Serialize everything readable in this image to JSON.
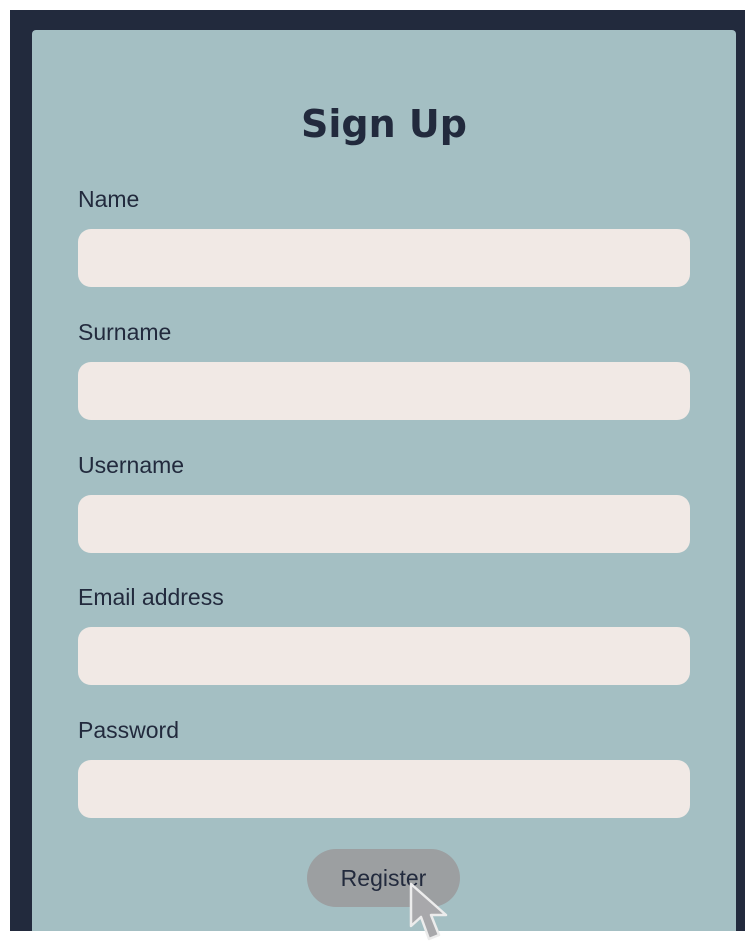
{
  "form": {
    "title": "Sign Up",
    "fields": [
      {
        "label": "Name",
        "value": "",
        "placeholder": ""
      },
      {
        "label": "Surname",
        "value": "",
        "placeholder": ""
      },
      {
        "label": "Username",
        "value": "",
        "placeholder": ""
      },
      {
        "label": "Email address",
        "value": "",
        "placeholder": ""
      },
      {
        "label": "Password",
        "value": "",
        "placeholder": ""
      }
    ],
    "submit_label": "Register"
  },
  "colors": {
    "frame": "#222a3d",
    "card": "#a4bfc3",
    "input": "#f1e9e5",
    "button": "#9c9fa1",
    "text": "#222a3d"
  },
  "icons": {
    "cursor": "mouse-pointer-icon"
  }
}
